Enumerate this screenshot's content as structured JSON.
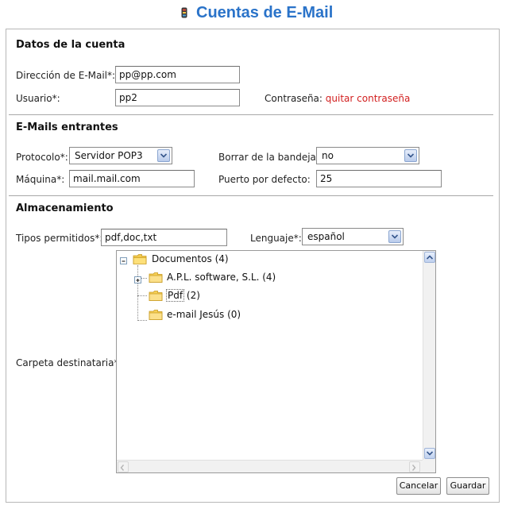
{
  "page": {
    "title": "Cuentas de E-Mail",
    "title_icon": "mail-account-icon",
    "accent": "#2a73c9"
  },
  "account": {
    "section_title": "Datos de la cuenta",
    "email_label": "Dirección de E-Mail*:",
    "email_value": "pp@pp.com",
    "user_label": "Usuario*:",
    "user_value": "pp2",
    "password_label": "Contraseña:",
    "password_link": "quitar contraseña",
    "link_color": "#d21f1f"
  },
  "incoming": {
    "section_title": "E-Mails entrantes",
    "protocol_label": "Protocolo*:",
    "protocol_value": "Servidor POP3",
    "delete_label": "Borrar de la bandeja:",
    "delete_value": "no",
    "host_label": "Máquina*:",
    "host_value": "mail.mail.com",
    "port_label": "Puerto por defecto:",
    "port_value": "25"
  },
  "storage": {
    "section_title": "Almacenamiento",
    "types_label": "Tipos permitidos*:",
    "types_value": "pdf,doc,txt",
    "language_label": "Lenguaje*:",
    "language_value": "español",
    "folder_label": "Carpeta destinataria*:",
    "tree": [
      {
        "name": "Documentos",
        "count": "(4)",
        "icon": "folder-open-icon",
        "toggle": "collapse"
      },
      {
        "name": "A.P.L. software, S.L.",
        "count": "(4)",
        "icon": "folder-icon",
        "toggle": "expand"
      },
      {
        "name": "Pdf",
        "count": "(2)",
        "icon": "folder-icon",
        "selected": true
      },
      {
        "name": "e-mail Jesús",
        "count": "(0)",
        "icon": "folder-icon"
      }
    ]
  },
  "actions": {
    "cancel": "Cancelar",
    "save": "Guardar"
  }
}
